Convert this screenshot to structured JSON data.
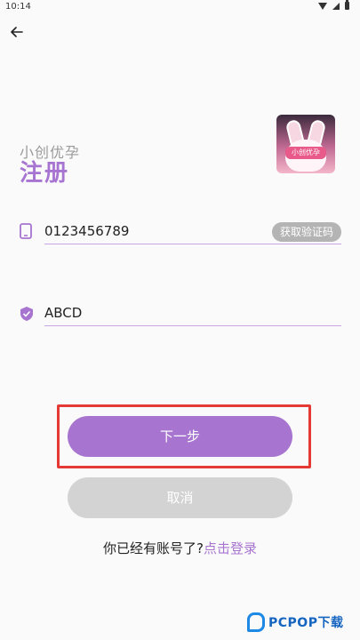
{
  "status_bar": {
    "time": "10:14",
    "icons": [
      "wifi-icon",
      "signal-icon",
      "battery-icon"
    ]
  },
  "header": {
    "back_icon": "arrow-left-icon"
  },
  "brand": {
    "app_name": "小创优孕",
    "logo_text": "小创优孕"
  },
  "page": {
    "title": "注册"
  },
  "form": {
    "phone": {
      "icon": "phone-icon",
      "value": "0123456789",
      "sms_button_label": "获取验证码"
    },
    "code": {
      "icon": "shield-icon",
      "value": "ABCD"
    }
  },
  "actions": {
    "next_label": "下一步",
    "cancel_label": "取消"
  },
  "footer": {
    "has_account_text": "你已经有账号了?",
    "login_link": "点击登录"
  },
  "watermark": {
    "text": "PCPOP下载"
  },
  "colors": {
    "accent": "#a774d0",
    "highlight": "#e53935",
    "disabled": "#d3d3d3",
    "sms_button": "#b4b4b4"
  }
}
